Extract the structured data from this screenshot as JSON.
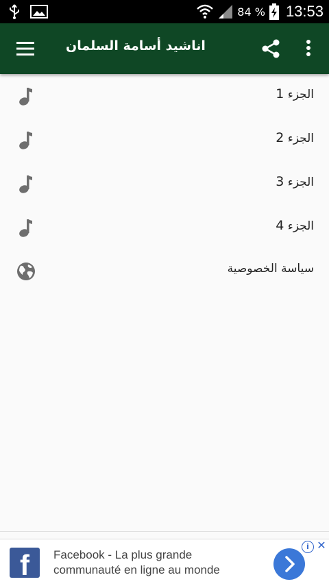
{
  "status_bar": {
    "battery_percent": "84 %",
    "time": "13:53"
  },
  "toolbar": {
    "title": "اناشيد أسامة السلمان"
  },
  "list": {
    "items": [
      {
        "label": "الجزء",
        "number": "1",
        "icon": "music-note-icon"
      },
      {
        "label": "الجزء",
        "number": "2",
        "icon": "music-note-icon"
      },
      {
        "label": "الجزء",
        "number": "3",
        "icon": "music-note-icon"
      },
      {
        "label": "الجزء",
        "number": "4",
        "icon": "music-note-icon"
      },
      {
        "label": "سياسة الخصوصية",
        "number": "",
        "icon": "globe-icon"
      }
    ]
  },
  "ad": {
    "logo_letter": "f",
    "line1": "Facebook - La plus grande",
    "line2": "communauté en ligne au monde",
    "info": "i",
    "close": "✕"
  },
  "colors": {
    "toolbar": "#0f4725",
    "icon_gray": "#6e6e6e",
    "facebook_blue": "#3b5998",
    "ad_button": "#3b78d8"
  }
}
